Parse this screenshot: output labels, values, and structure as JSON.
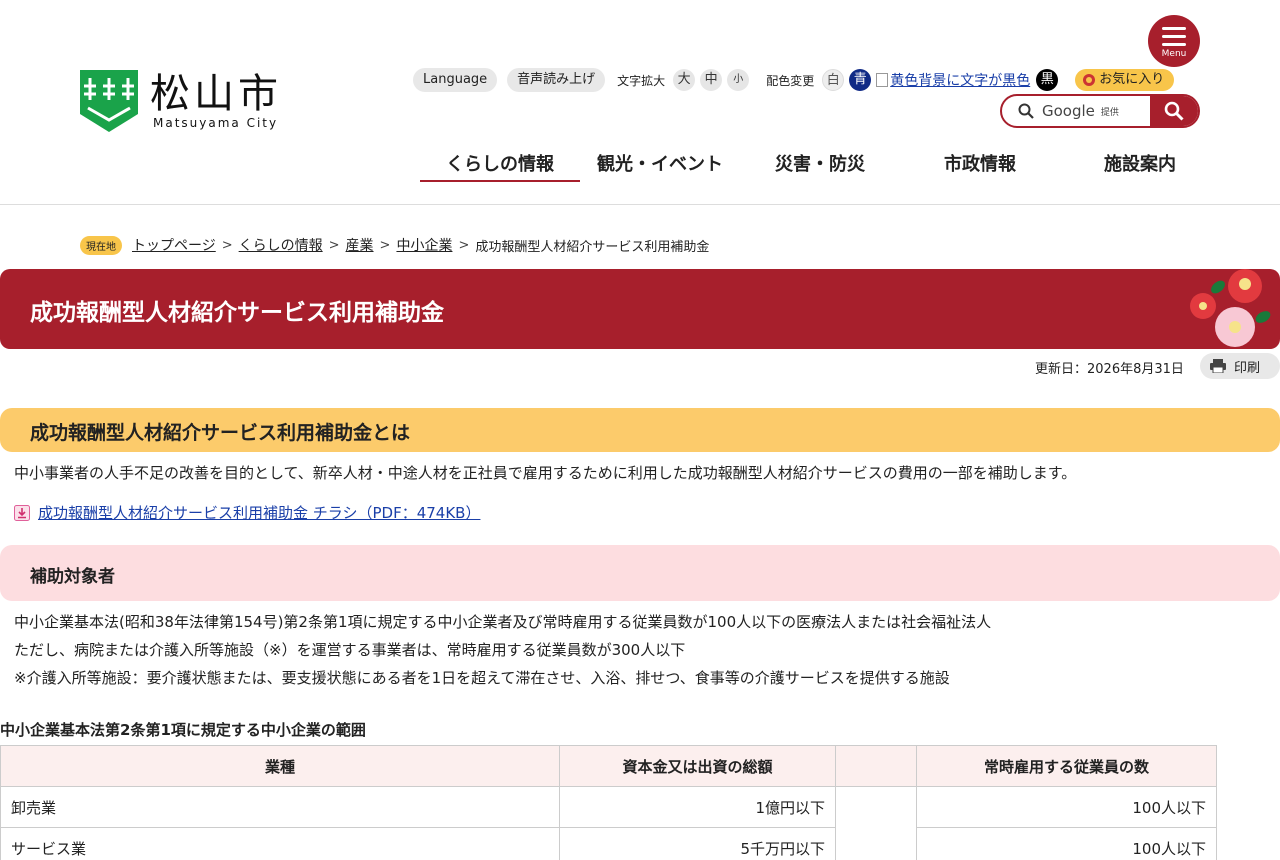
{
  "header": {
    "logo": {
      "kanji": "松山市",
      "roman": "Matsuyama City"
    },
    "menu_label": "Menu",
    "utility": {
      "language": "Language",
      "read_aloud": "音声読み上げ",
      "text_size_label": "文字拡大",
      "size_large": "大",
      "size_medium": "中",
      "size_small": "小",
      "color_label": "配色変更",
      "color_white": "白",
      "color_blue": "青",
      "color_yellow_alt": "黄色背景に文字が黒色",
      "color_black": "黒",
      "favorites": "お気に入り"
    },
    "search": {
      "brand": "Google",
      "provided": "提供"
    },
    "nav": [
      "くらしの情報",
      "観光・イベント",
      "災害・防災",
      "市政情報",
      "施設案内"
    ]
  },
  "breadcrumb": {
    "here_label": "現在地",
    "links": [
      "トップページ",
      "くらしの情報",
      "産業",
      "中小企業"
    ],
    "current": "成功報酬型人材紹介サービス利用補助金"
  },
  "page": {
    "title": "成功報酬型人材紹介サービス利用補助金",
    "updated": "更新日：2026年8月31日",
    "print_label": "印刷"
  },
  "section1": {
    "heading": "成功報酬型人材紹介サービス利用補助金とは",
    "body": "中小事業者の人手不足の改善を目的として、新卒人材・中途人材を正社員で雇用するために利用した成功報酬型人材紹介サービスの費用の一部を補助します。",
    "pdf_link": "成功報酬型人材紹介サービス利用補助金 チラシ（PDF：474KB）"
  },
  "section2": {
    "heading": "補助対象者",
    "lines": [
      "中小企業基本法(昭和38年法律第154号)第2条第1項に規定する中小企業者及び常時雇用する従業員数が100人以下の医療法人または社会福祉法人",
      "ただし、病院または介護入所等施設（※）を運営する事業者は、常時雇用する従業員数が300人以下",
      "※介護入所等施設：要介護状態または、要支援状態にある者を1日を超えて滞在させ、入浴、排せつ、食事等の介護サービスを提供する施設"
    ]
  },
  "table": {
    "caption": "中小企業基本法第2条第1項に規定する中小企業の範囲",
    "headers": [
      "業種",
      "資本金又は出資の総額",
      "",
      "常時雇用する従業員の数"
    ],
    "rows": [
      {
        "industry": "卸売業",
        "capital": "1億円以下",
        "employees": "100人以下"
      },
      {
        "industry": "サービス業",
        "capital": "5千万円以下",
        "employees": "100人以下"
      }
    ]
  },
  "colors": {
    "brand_red": "#a71f2c",
    "yellow": "#fccb6b",
    "pink": "#fddde0",
    "logo_green": "#1aa34a",
    "blue": "#102a86"
  }
}
